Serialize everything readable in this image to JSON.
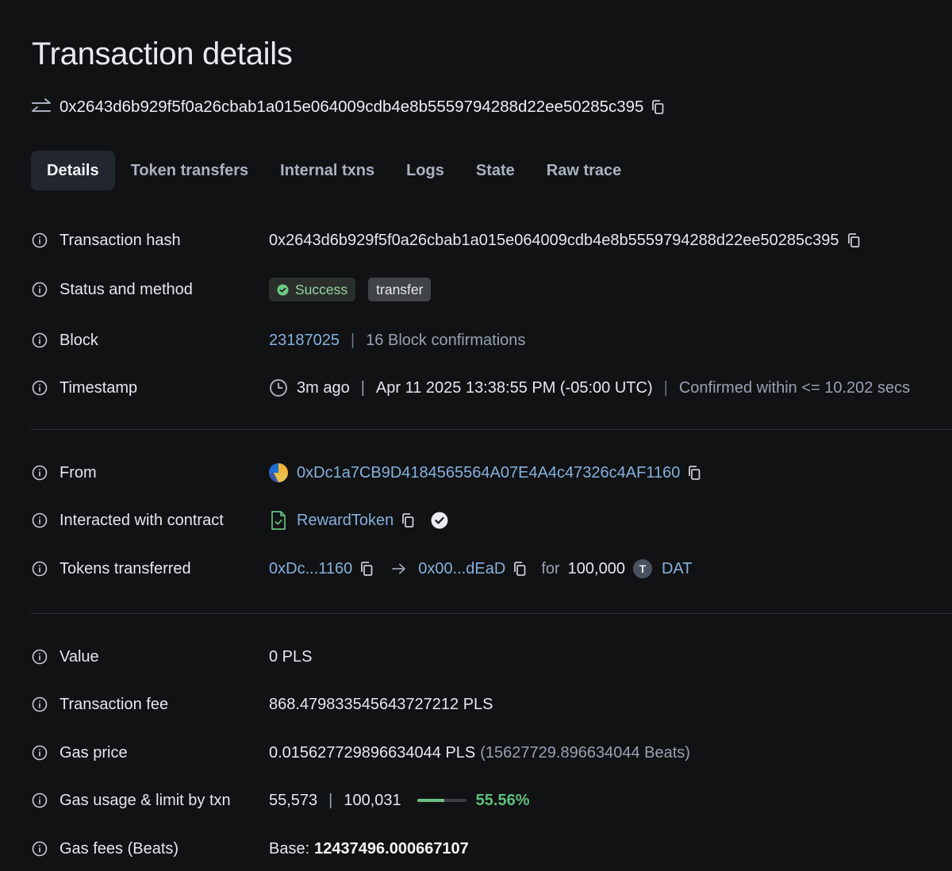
{
  "page": {
    "title": "Transaction details"
  },
  "hash_header": {
    "hash": "0x2643d6b929f5f0a26cbab1a015e064009cdb4e8b5559794288d22ee50285c395"
  },
  "tabs": [
    {
      "label": "Details",
      "active": true
    },
    {
      "label": "Token transfers"
    },
    {
      "label": "Internal txns"
    },
    {
      "label": "Logs"
    },
    {
      "label": "State"
    },
    {
      "label": "Raw trace"
    }
  ],
  "rows": {
    "tx_hash": {
      "label": "Transaction hash",
      "value": "0x2643d6b929f5f0a26cbab1a015e064009cdb4e8b5559794288d22ee50285c395"
    },
    "status": {
      "label": "Status and method",
      "status": "Success",
      "method": "transfer"
    },
    "block": {
      "label": "Block",
      "number": "23187025",
      "sep": "|",
      "confirmations": "16 Block confirmations"
    },
    "timestamp": {
      "label": "Timestamp",
      "ago": "3m ago",
      "sep": "|",
      "datetime": "Apr 11 2025 13:38:55 PM (-05:00 UTC)",
      "sep2": "|",
      "confirmed": "Confirmed within <= 10.202 secs"
    },
    "from": {
      "label": "From",
      "address": "0xDc1a7CB9D4184565564A07E4A4c47326c4AF1160"
    },
    "contract": {
      "label": "Interacted with contract",
      "name": "RewardToken"
    },
    "tokens": {
      "label": "Tokens transferred",
      "from": "0xDc...1160",
      "to": "0x00...dEaD",
      "for_label": "for",
      "amount": "100,000",
      "token_letter": "T",
      "token_symbol": "DAT"
    },
    "value": {
      "label": "Value",
      "value": "0 PLS"
    },
    "fee": {
      "label": "Transaction fee",
      "value": "868.479833545643727212 PLS"
    },
    "gas_price": {
      "label": "Gas price",
      "value": "0.015627729896634044 PLS",
      "beats": "(15627729.896634044 Beats)"
    },
    "gas_usage": {
      "label": "Gas usage & limit by txn",
      "used": "55,573",
      "sep": "|",
      "limit": "100,031",
      "usage_fraction": 0.5556,
      "percent": "55.56%"
    },
    "gas_fees": {
      "label": "Gas fees (Beats)",
      "base_label": "Base:",
      "base_value": "12437496.000667107"
    }
  },
  "colors": {
    "background": "#111214",
    "link": "#86b0dc",
    "success": "#5fbf7b",
    "muted": "#97a2b2"
  },
  "icons": [
    "swap-arrows-icon",
    "copy-icon",
    "info-icon",
    "check-circle-icon",
    "clock-icon",
    "address-avatar-icon",
    "contract-file-icon",
    "verified-icon",
    "arrow-right-icon",
    "token-icon"
  ]
}
